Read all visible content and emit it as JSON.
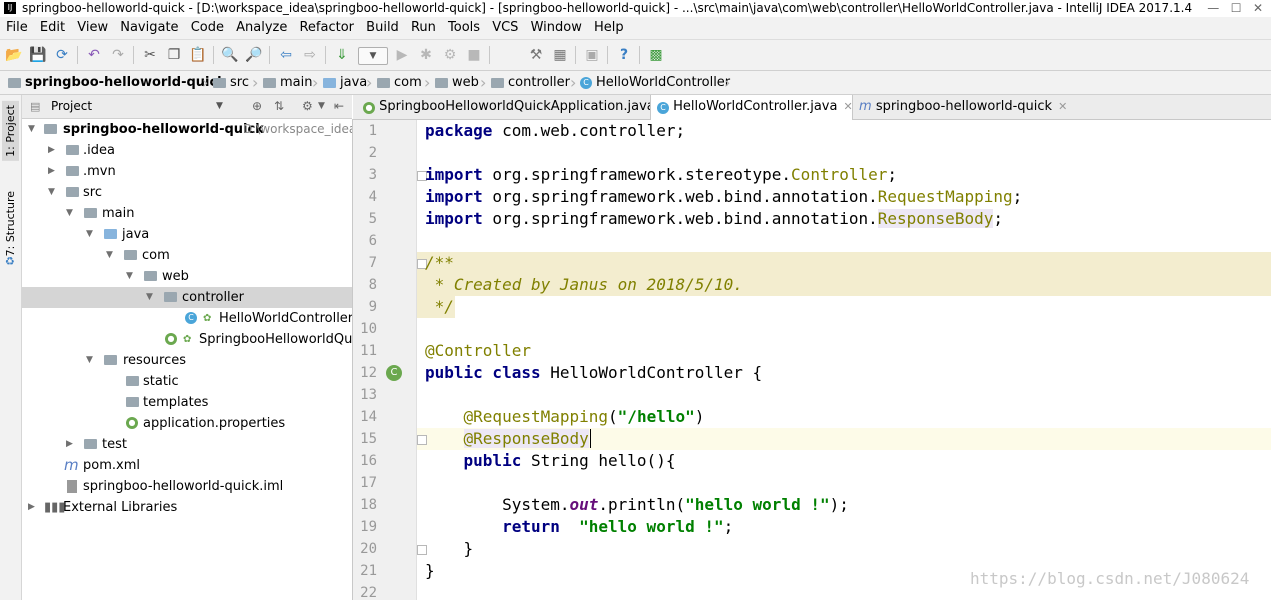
{
  "window": {
    "title": "springboo-helloworld-quick - [D:\\workspace_idea\\springboo-helloworld-quick] - [springboo-helloworld-quick] - ...\\src\\main\\java\\com\\web\\controller\\HelloWorldController.java - IntelliJ IDEA 2017.1.4",
    "app_icon": "IJ"
  },
  "menu": [
    "File",
    "Edit",
    "View",
    "Navigate",
    "Code",
    "Analyze",
    "Refactor",
    "Build",
    "Run",
    "Tools",
    "VCS",
    "Window",
    "Help"
  ],
  "breadcrumbs": [
    "springboo-helloworld-quick",
    "src",
    "main",
    "java",
    "com",
    "web",
    "controller",
    "HelloWorldController"
  ],
  "project_panel": {
    "title": "Project",
    "tree": [
      {
        "label": "springboo-helloworld-quick",
        "path": "D:\\workspace_idea",
        "depth": 0,
        "expanded": true,
        "icon": "module-folder-icon",
        "bold": true
      },
      {
        "label": ".idea",
        "depth": 1,
        "expanded": false,
        "icon": "folder-icon"
      },
      {
        "label": ".mvn",
        "depth": 1,
        "expanded": false,
        "icon": "folder-icon"
      },
      {
        "label": "src",
        "depth": 1,
        "expanded": true,
        "icon": "folder-icon"
      },
      {
        "label": "main",
        "depth": 2,
        "expanded": true,
        "icon": "folder-icon"
      },
      {
        "label": "java",
        "depth": 3,
        "expanded": true,
        "icon": "source-folder-icon"
      },
      {
        "label": "com",
        "depth": 4,
        "expanded": true,
        "icon": "package-icon"
      },
      {
        "label": "web",
        "depth": 5,
        "expanded": true,
        "icon": "package-icon"
      },
      {
        "label": "controller",
        "depth": 6,
        "expanded": true,
        "icon": "package-icon",
        "selected": true
      },
      {
        "label": "HelloWorldController",
        "depth": 8,
        "icon": "java-class-icon"
      },
      {
        "label": "SpringbooHelloworldQuic",
        "depth": 7,
        "icon": "spring-boot-class-icon"
      },
      {
        "label": "resources",
        "depth": 3,
        "expanded": true,
        "icon": "resources-folder-icon"
      },
      {
        "label": "static",
        "depth": 5,
        "icon": "folder-icon"
      },
      {
        "label": "templates",
        "depth": 5,
        "icon": "folder-icon"
      },
      {
        "label": "application.properties",
        "depth": 5,
        "icon": "properties-file-icon"
      },
      {
        "label": "test",
        "depth": 2,
        "expanded": false,
        "icon": "folder-icon"
      },
      {
        "label": "pom.xml",
        "depth": 1,
        "icon": "maven-icon"
      },
      {
        "label": "springboo-helloworld-quick.iml",
        "depth": 1,
        "icon": "iml-file-icon"
      },
      {
        "label": "External Libraries",
        "depth": 0,
        "expanded": false,
        "icon": "libraries-icon"
      }
    ]
  },
  "side_tabs": [
    "1: Project",
    "7: Structure"
  ],
  "editor_tabs": [
    {
      "label": "SpringbooHelloworldQuickApplication.java",
      "active": false,
      "icon": "spring-boot-class-icon"
    },
    {
      "label": "HelloWorldController.java",
      "active": true,
      "icon": "java-class-icon"
    },
    {
      "label": "springboo-helloworld-quick",
      "active": false,
      "icon": "maven-icon"
    }
  ],
  "code_lines": [
    "package com.web.controller;",
    "",
    "import org.springframework.stereotype.Controller;",
    "import org.springframework.web.bind.annotation.RequestMapping;",
    "import org.springframework.web.bind.annotation.ResponseBody;",
    "",
    "/**",
    " * Created by Janus on 2018/5/10.",
    " */",
    "",
    "@Controller",
    "public class HelloWorldController {",
    "",
    "    @RequestMapping(\"/hello\")",
    "    @ResponseBody",
    "    public String hello(){",
    "",
    "        System.out.println(\"hello world !\");",
    "        return  \"hello world !\";",
    "    }",
    "}",
    ""
  ],
  "current_line": 15,
  "watermark": "https://blog.csdn.net/J080624"
}
